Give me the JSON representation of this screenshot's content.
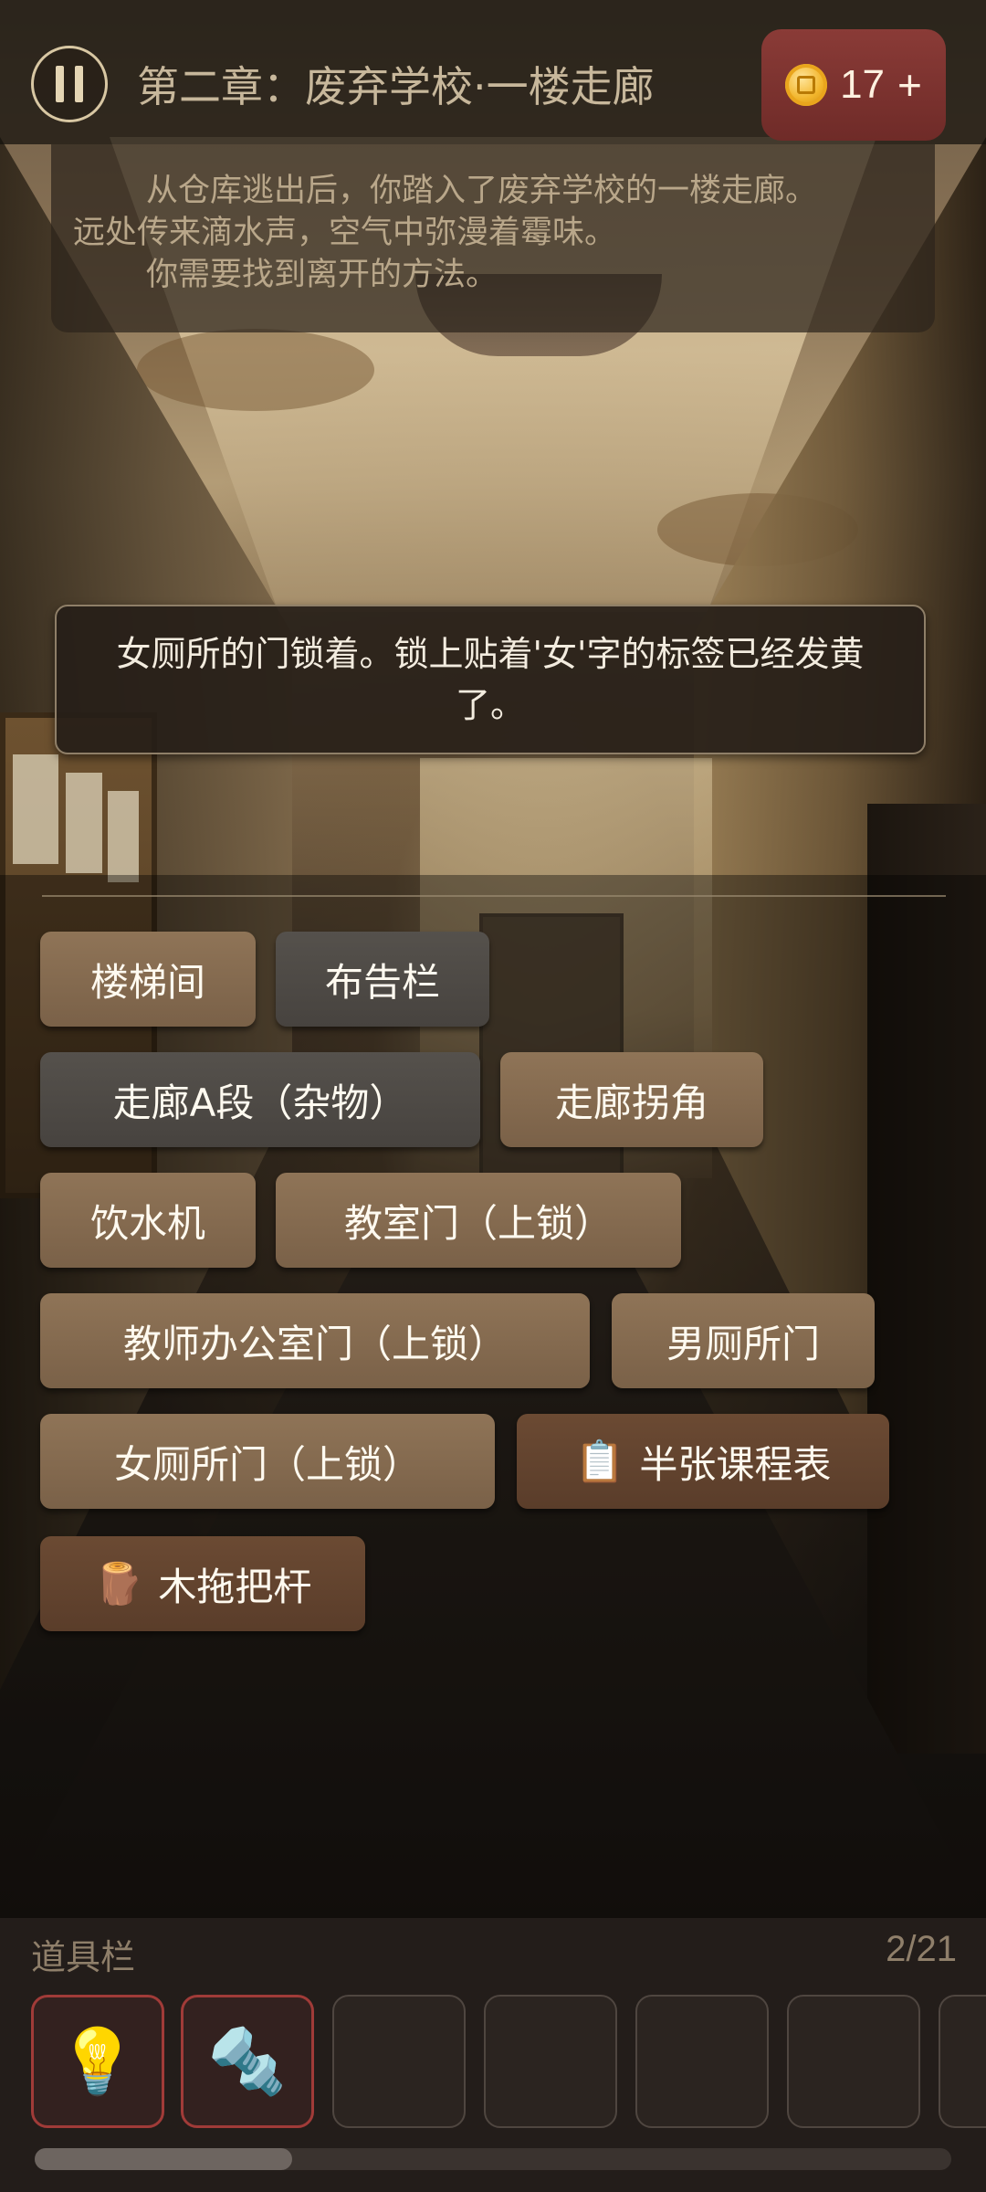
{
  "header": {
    "chapter_title": "第二章：废弃学校·一楼走廊",
    "coins": "17",
    "coin_plus": "+",
    "pause_icon": "pause-icon",
    "coin_icon": "coin-icon"
  },
  "narrative": {
    "line1": "从仓库逃出后，你踏入了废弃学校的一楼走廊。",
    "line2": "远处传来滴水声，空气中弥漫着霉味。",
    "line3": "你需要找到离开的方法。"
  },
  "message": {
    "text": "女厕所的门锁着。锁上贴着'女'字的标签已经发黄了。"
  },
  "actions": [
    {
      "label": "楼梯间",
      "style": "brown"
    },
    {
      "label": "布告栏",
      "style": "gray"
    },
    {
      "label": "走廊A段（杂物）",
      "style": "gray"
    },
    {
      "label": "走廊拐角",
      "style": "brown"
    },
    {
      "label": "饮水机",
      "style": "brown"
    },
    {
      "label": "教室门（上锁）",
      "style": "brown"
    },
    {
      "label": "教师办公室门（上锁）",
      "style": "brown"
    },
    {
      "label": "男厕所门",
      "style": "brown"
    },
    {
      "label": "女厕所门（上锁）",
      "style": "brown"
    },
    {
      "label": "半张课程表",
      "style": "dark",
      "icon": "📋",
      "icon_name": "clipboard-icon"
    },
    {
      "label": "木拖把杆",
      "style": "dark",
      "icon": "🪵",
      "icon_name": "wood-stick-icon"
    }
  ],
  "inventory": {
    "title": "道具栏",
    "count": "2/21",
    "slots": [
      {
        "icon": "💡",
        "icon_name": "lightbulb-icon",
        "filled": true
      },
      {
        "icon": "🔩",
        "icon_name": "bolt-icon",
        "filled": true
      },
      {
        "icon": "",
        "filled": false
      },
      {
        "icon": "",
        "filled": false
      },
      {
        "icon": "",
        "filled": false
      },
      {
        "icon": "",
        "filled": false
      }
    ]
  }
}
